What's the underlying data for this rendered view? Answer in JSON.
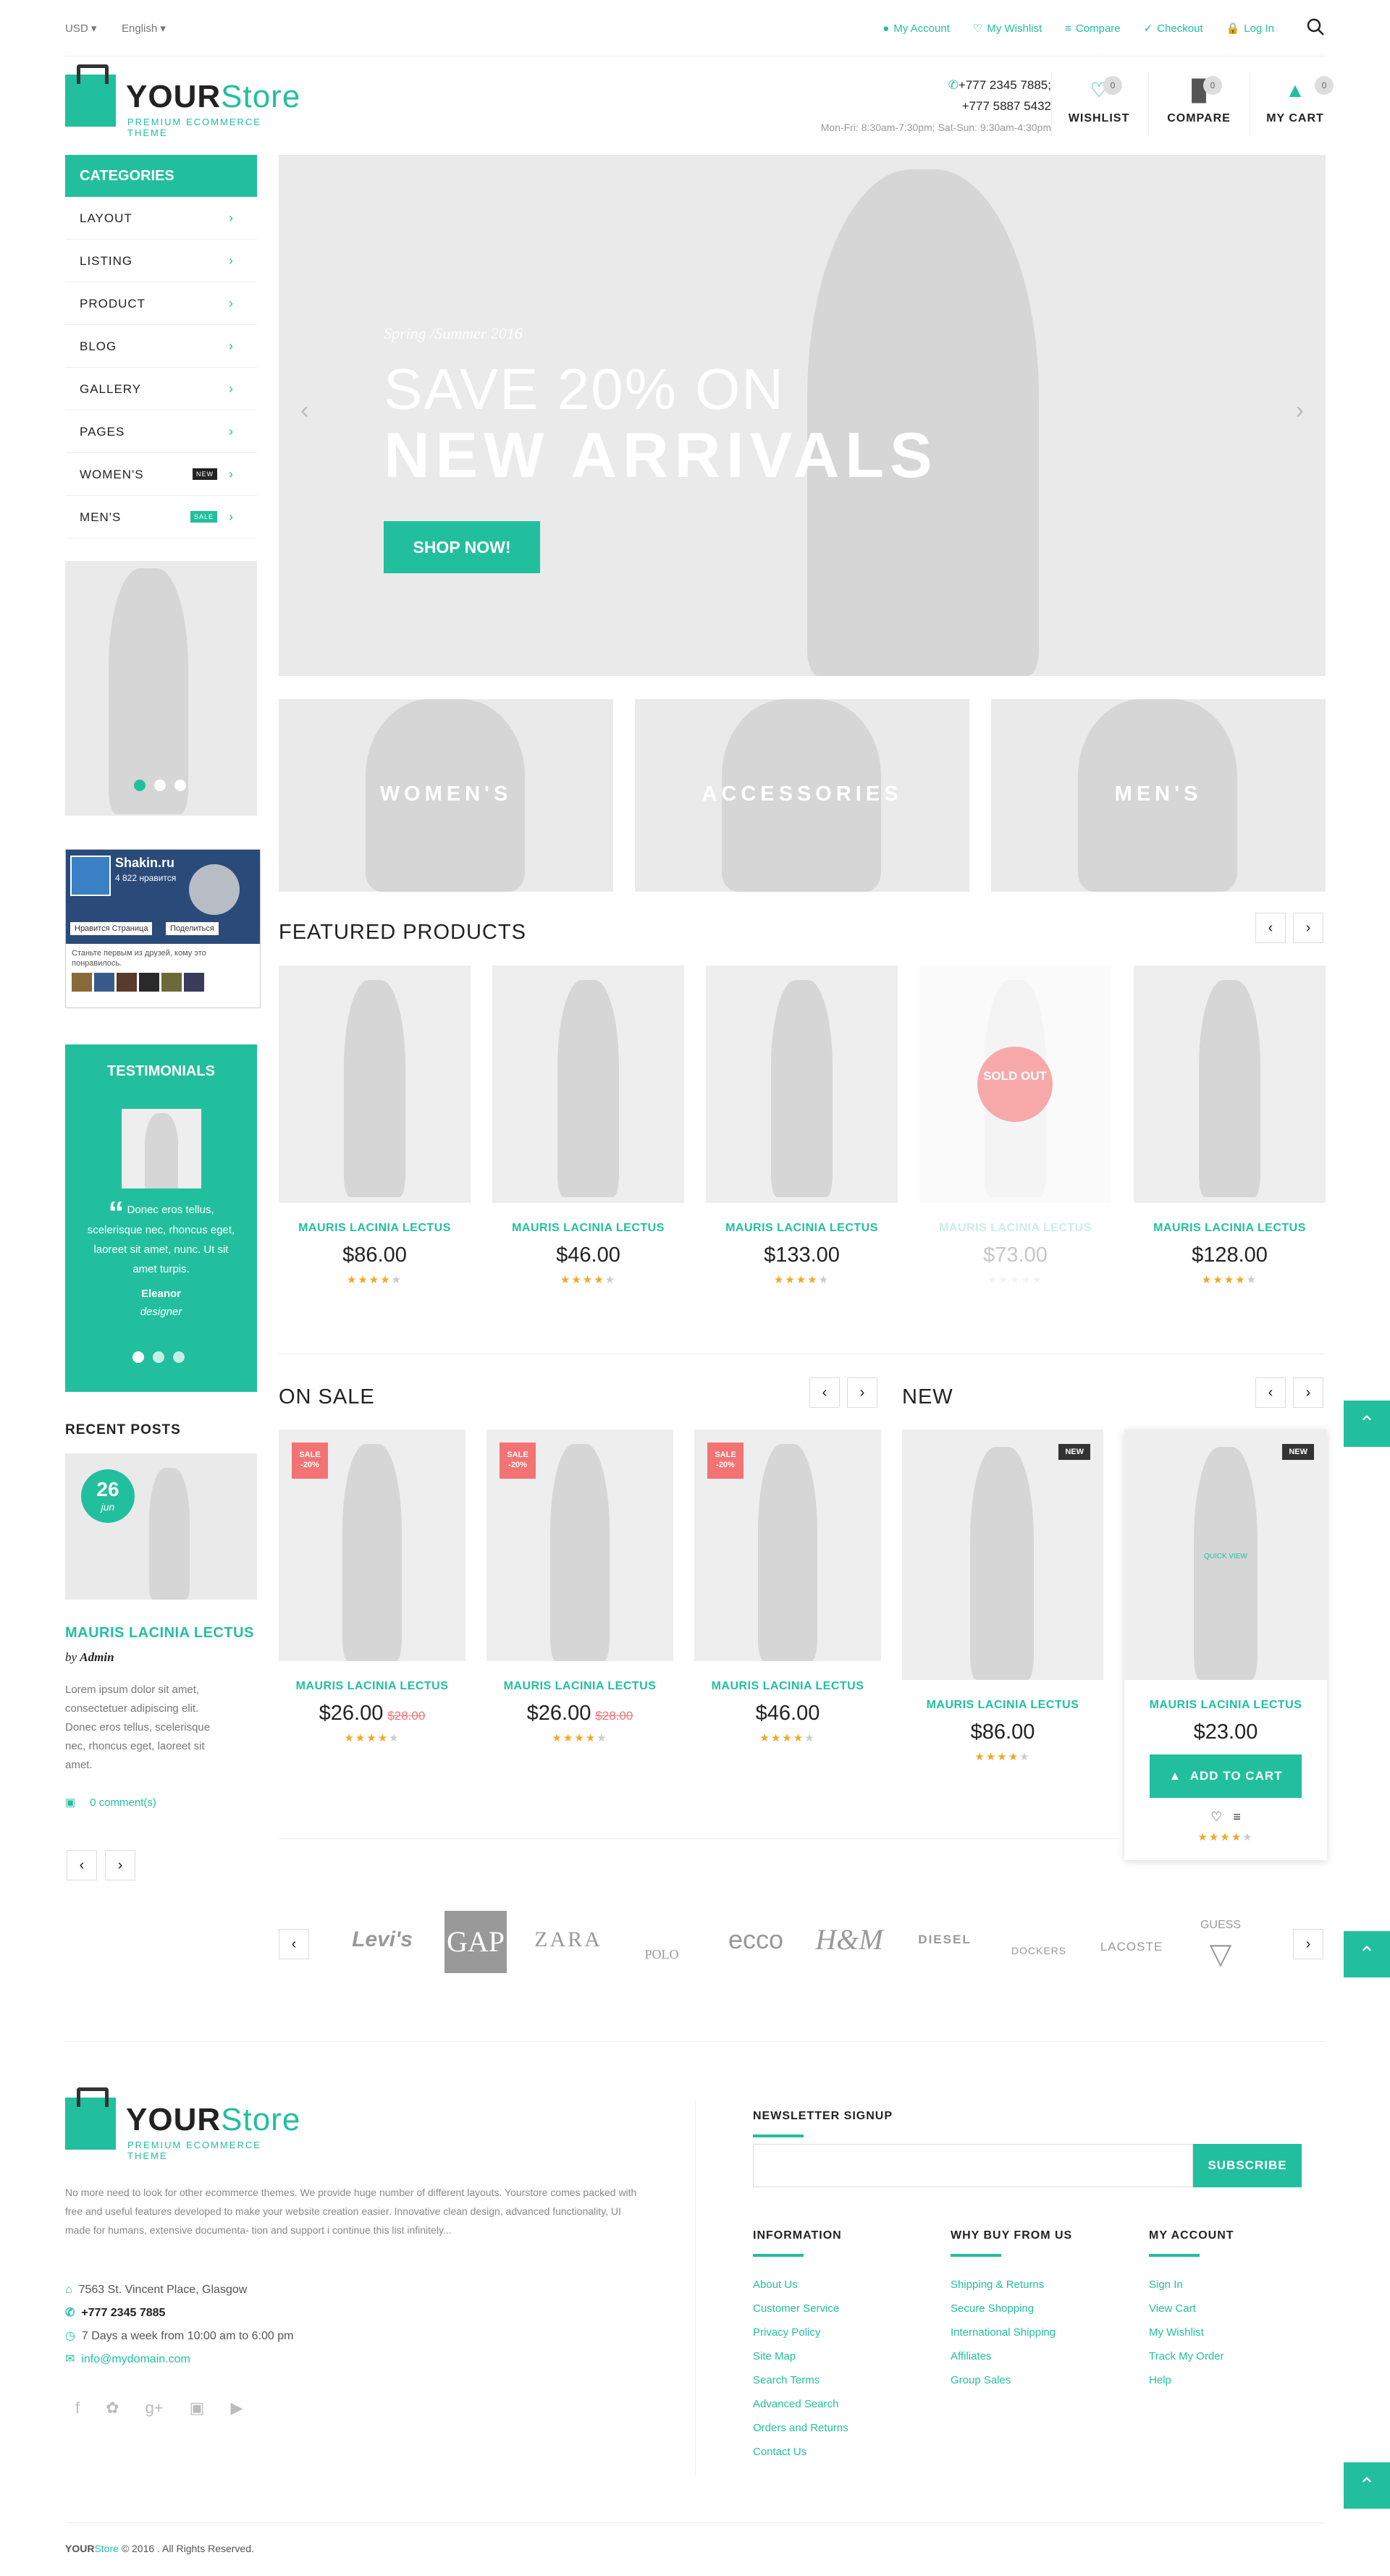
{
  "topbar": {
    "currency": "USD",
    "language": "English",
    "links": [
      "My Account",
      "My Wishlist",
      "Compare",
      "Checkout",
      "Log In"
    ]
  },
  "logo": {
    "your": "YOUR",
    "store": "Store",
    "tagline": "PREMIUM ECOMMERCE THEME"
  },
  "contact": {
    "phone1": "+777 2345 7885;",
    "phone2": "+777 5887 5432",
    "hours": "Mon-Fri: 8:30am-7:30pm; Sat-Sun: 9:30am-4:30pm"
  },
  "header_icons": [
    {
      "label": "WISHLIST",
      "count": "0",
      "icon": "heart-icon"
    },
    {
      "label": "COMPARE",
      "count": "0",
      "icon": "compare-icon"
    },
    {
      "label": "MY CART",
      "count": "0",
      "icon": "basket-icon"
    }
  ],
  "categories": {
    "title": "CATEGORIES",
    "items": [
      {
        "label": "LAYOUT"
      },
      {
        "label": "LISTING"
      },
      {
        "label": "PRODUCT"
      },
      {
        "label": "BLOG"
      },
      {
        "label": "GALLERY"
      },
      {
        "label": "PAGES"
      },
      {
        "label": "WOMEN'S",
        "badge": "NEW"
      },
      {
        "label": "MEN'S",
        "badge": "SALE"
      }
    ]
  },
  "facebook": {
    "page": "Shakin.ru",
    "likes": "4 822 нравится",
    "like_btn": "Нравится Страница",
    "share_btn": "Поделиться",
    "note": "Станьте первым из друзей, кому это понравилось."
  },
  "testimonials": {
    "title": "TESTIMONIALS",
    "quote": "Donec eros tellus, scelerisque nec, rhoncus eget, laoreet sit amet, nunc. Ut sit amet turpis.",
    "author": "Eleanor",
    "role": "designer"
  },
  "recent_posts": {
    "title": "RECENT POSTS",
    "day": "26",
    "month": "jun",
    "post_title": "MAURIS LACINIA LECTUS",
    "by": "by",
    "author": "Admin",
    "excerpt": "Lorem ipsum dolor sit amet, consectetuer adipiscing elit. Donec eros tellus, scelerisque nec, rhoncus eget, laoreet sit amet.",
    "comments": "0 comment(s)"
  },
  "hero": {
    "subtitle": "Spring /Summer 2016",
    "line1": "SAVE 20% ON",
    "line2": "NEW ARRIVALS",
    "cta": "SHOP NOW!"
  },
  "banners": [
    "WOMEN'S",
    "ACCESSORIES",
    "MEN'S"
  ],
  "featured": {
    "title": "FEATURED PRODUCTS",
    "items": [
      {
        "name": "MAURIS LACINIA LECTUS",
        "price": "$86.00"
      },
      {
        "name": "MAURIS LACINIA LECTUS",
        "price": "$46.00"
      },
      {
        "name": "MAURIS LACINIA LECTUS",
        "price": "$133.00"
      },
      {
        "name": "MAURIS LACINIA LECTUS",
        "price": "$73.00",
        "sold_out": "SOLD OUT"
      },
      {
        "name": "MAURIS LACINIA LECTUS",
        "price": "$128.00"
      }
    ]
  },
  "on_sale": {
    "title": "ON SALE",
    "badge": "SALE -20%",
    "items": [
      {
        "name": "MAURIS LACINIA LECTUS",
        "price": "$26.00",
        "old": "$28.00"
      },
      {
        "name": "MAURIS LACINIA LECTUS",
        "price": "$26.00",
        "old": "$28.00"
      },
      {
        "name": "MAURIS LACINIA LECTUS",
        "price": "$46.00"
      }
    ]
  },
  "new_section": {
    "title": "NEW",
    "badge": "NEW",
    "quick_view": "QUICK VIEW",
    "add_to_cart": "ADD TO CART",
    "items": [
      {
        "name": "MAURIS LACINIA LECTUS",
        "price": "$86.00"
      },
      {
        "name": "MAURIS LACINIA LECTUS",
        "price": "$23.00"
      }
    ]
  },
  "brands": [
    "Levi's",
    "GAP",
    "ZARA",
    "POLO",
    "ecco",
    "H&M",
    "DIESEL",
    "DOCKERS",
    "LACOSTE",
    "GUESS"
  ],
  "footer": {
    "about": "No more need to look for other ecommerce themes. We provide huge number of different layouts. Yourstore comes packed with free and useful features developed to make your website creation easier. Innovative clean design, advanced functionality, UI made for humans, extensive documenta- tion and support i continue this list infinitely...",
    "address": "7563 St. Vincent Place, Glasgow",
    "phone": "+777 2345 7885",
    "hours": "7 Days a week from 10:00 am to 6:00 pm",
    "email": "info@mydomain.com",
    "newsletter_title": "NEWSLETTER SIGNUP",
    "subscribe": "SUBSCRIBE",
    "col1": {
      "title": "INFORMATION",
      "links": [
        "About Us",
        "Customer Service",
        "Privacy Policy",
        "Site Map",
        "Search Terms",
        "Advanced Search",
        "Orders and Returns",
        "Contact Us"
      ]
    },
    "col2": {
      "title": "WHY BUY FROM US",
      "links": [
        "Shipping & Returns",
        "Secure Shopping",
        "International Shipping",
        "Affiliates",
        "Group Sales"
      ]
    },
    "col3": {
      "title": "MY ACCOUNT",
      "links": [
        "Sign In",
        "View Cart",
        "My Wishlist",
        "Track My Order",
        "Help"
      ]
    },
    "copyright": "© 2016 . All Rights Reserved."
  },
  "colors": {
    "accent": "#22bf9f",
    "sale": "#f37374"
  }
}
